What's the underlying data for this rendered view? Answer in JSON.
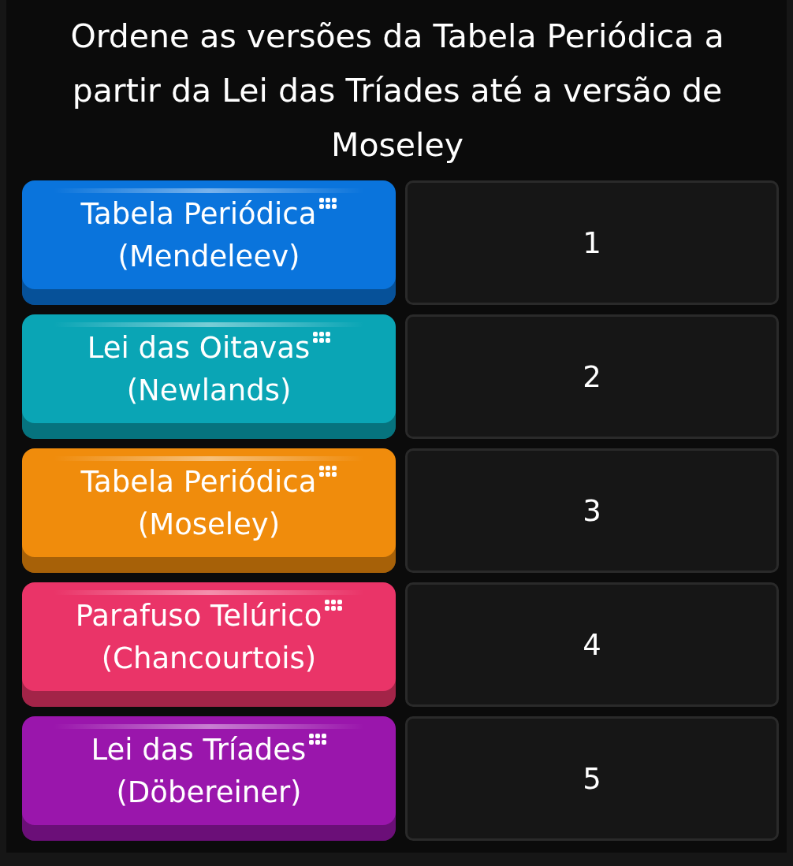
{
  "question": "Ordene as versões da Tabela Periódica a partir da Lei das Tríades até a versão de Moseley",
  "cards": [
    {
      "line1": "Tabela Periódica",
      "line2": "(Mendeleev)",
      "color": "#0a74dc"
    },
    {
      "line1": "Lei das Oitavas",
      "line2": "(Newlands)",
      "color": "#0aa5b5"
    },
    {
      "line1": "Tabela Periódica",
      "line2": "(Moseley)",
      "color": "#f08c0c"
    },
    {
      "line1": "Parafuso Telúrico",
      "line2": "(Chancourtois)",
      "color": "#ea3468"
    },
    {
      "line1": "Lei das Tríades",
      "line2": "(Döbereiner)",
      "color": "#9a16ac"
    }
  ],
  "slots": [
    "1",
    "2",
    "3",
    "4",
    "5"
  ]
}
